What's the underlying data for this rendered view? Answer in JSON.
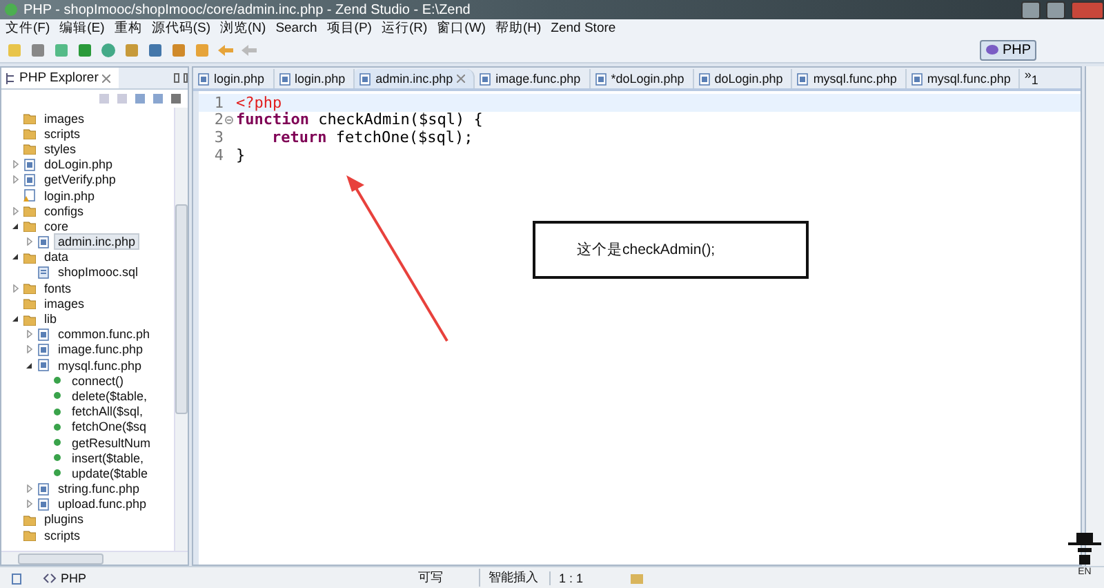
{
  "window": {
    "title": "PHP - shopImooc/shopImooc/core/admin.inc.php - Zend Studio - E:\\Zend"
  },
  "menu": [
    "文件(F)",
    "编辑(E)",
    "重构",
    "源代码(S)",
    "浏览(N)",
    "Search",
    "项目(P)",
    "运行(R)",
    "窗口(W)",
    "帮助(H)",
    "Zend Store"
  ],
  "perspective": {
    "label": "PHP",
    "selected": true
  },
  "explorer": {
    "title": "PHP Explorer",
    "tree": [
      {
        "children": [
          {
            "label": "images",
            "kind": "folder",
            "expandable": false,
            "selected": false
          },
          {
            "label": "scripts",
            "kind": "folder",
            "expandable": false,
            "selected": false
          },
          {
            "label": "styles",
            "kind": "folder",
            "expandable": false,
            "selected": false
          },
          {
            "label": "doLogin.php",
            "kind": "php",
            "expandable": true,
            "expanded": false,
            "selected": false
          },
          {
            "label": "getVerify.php",
            "kind": "php",
            "expandable": true,
            "expanded": false,
            "selected": false
          },
          {
            "label": "login.php",
            "kind": "php-warning",
            "expandable": false,
            "selected": false
          }
        ]
      },
      {
        "label": "configs",
        "kind": "folder",
        "expandable": true,
        "expanded": false,
        "selected": false
      },
      {
        "label": "core",
        "kind": "folder",
        "expandable": true,
        "expanded": true,
        "selected": false,
        "children": [
          {
            "label": "admin.inc.php",
            "kind": "php",
            "expandable": true,
            "expanded": false,
            "selected": true
          }
        ]
      },
      {
        "label": "data",
        "kind": "folder",
        "expandable": true,
        "expanded": true,
        "selected": false,
        "children": [
          {
            "label": "shopImooc.sql",
            "kind": "sql",
            "expandable": false,
            "selected": false
          }
        ]
      },
      {
        "label": "fonts",
        "kind": "folder",
        "expandable": true,
        "expanded": false,
        "selected": false
      },
      {
        "label": "images",
        "kind": "folder",
        "expandable": false,
        "selected": false
      },
      {
        "label": "lib",
        "kind": "folder",
        "expandable": true,
        "expanded": true,
        "selected": false,
        "children": [
          {
            "label": "common.func.ph",
            "kind": "php",
            "expandable": true,
            "expanded": false,
            "selected": false
          },
          {
            "label": "image.func.php",
            "kind": "php",
            "expandable": true,
            "expanded": false,
            "selected": false
          },
          {
            "label": "mysql.func.php",
            "kind": "php",
            "expandable": true,
            "expanded": true,
            "selected": false,
            "children": [
              {
                "label": "connect()",
                "kind": "function",
                "expandable": false,
                "selected": false
              },
              {
                "label": "delete($table,",
                "kind": "function",
                "expandable": false,
                "selected": false
              },
              {
                "label": "fetchAll($sql,",
                "kind": "function",
                "expandable": false,
                "selected": false
              },
              {
                "label": "fetchOne($sq",
                "kind": "function",
                "expandable": false,
                "selected": false
              },
              {
                "label": "getResultNum",
                "kind": "function",
                "expandable": false,
                "selected": false
              },
              {
                "label": "insert($table,",
                "kind": "function",
                "expandable": false,
                "selected": false
              },
              {
                "label": "update($table",
                "kind": "function",
                "expandable": false,
                "selected": false
              }
            ]
          },
          {
            "label": "string.func.php",
            "kind": "php",
            "expandable": true,
            "expanded": false,
            "selected": false
          },
          {
            "label": "upload.func.php",
            "kind": "php",
            "expandable": true,
            "expanded": false,
            "selected": false
          }
        ]
      },
      {
        "label": "plugins",
        "kind": "folder",
        "expandable": false,
        "selected": false
      },
      {
        "label": "scripts",
        "kind": "folder",
        "expandable": false,
        "selected": false
      }
    ]
  },
  "editor_tabs": [
    {
      "label": "login.php",
      "selected": false
    },
    {
      "label": "login.php",
      "selected": false
    },
    {
      "label": "admin.inc.php",
      "selected": true
    },
    {
      "label": "image.func.php",
      "selected": false
    },
    {
      "label": "*doLogin.php",
      "selected": false
    },
    {
      "label": "doLogin.php",
      "selected": false
    },
    {
      "label": "mysql.func.php",
      "selected": false
    },
    {
      "label": "mysql.func.php",
      "selected": false
    }
  ],
  "tab_overflow": {
    "arrow": "»",
    "count": "1"
  },
  "code": [
    {
      "number": "1",
      "folding": false,
      "indented": false,
      "tokens": [
        {
          "text": "<?php",
          "kind": "tag"
        }
      ]
    },
    {
      "number": "2",
      "folding": true,
      "indented": false,
      "tokens": [
        {
          "text": "function",
          "kind": "keyword"
        },
        {
          "text": " checkAdmin($sql) {",
          "kind": "plain"
        }
      ]
    },
    {
      "number": "3",
      "folding": false,
      "indented": true,
      "tokens": [
        {
          "text": "return",
          "kind": "keyword"
        },
        {
          "text": " fetchOne($sql);",
          "kind": "plain"
        }
      ]
    },
    {
      "number": "4",
      "folding": false,
      "indented": false,
      "tokens": [
        {
          "text": "}",
          "kind": "plain"
        }
      ]
    }
  ],
  "annotation": {
    "text": "这个是checkAdmin();"
  },
  "ime": {
    "label": "EN"
  },
  "status_bar": {
    "mode": "PHP",
    "writable": "可写",
    "insert_mode": "智能插入",
    "position": "1 : 1"
  }
}
